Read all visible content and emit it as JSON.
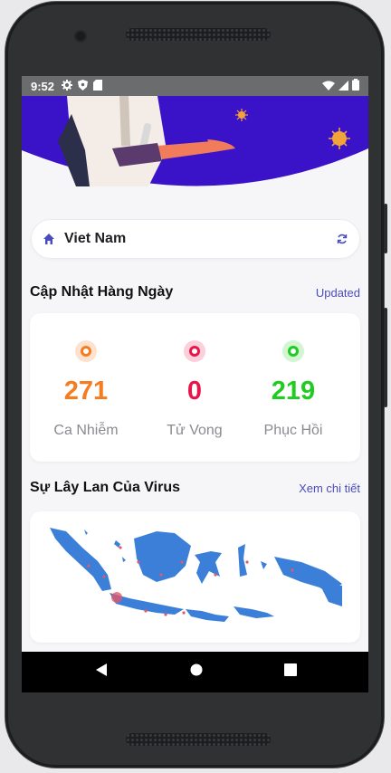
{
  "status_bar": {
    "time": "9:52"
  },
  "location": {
    "country": "Viet Nam"
  },
  "daily_update": {
    "title": "Cập Nhật Hàng Ngày",
    "link": "Updated",
    "stats": [
      {
        "value": "271",
        "label": "Ca Nhiễm",
        "color": "#f57c1f",
        "halo": "#fde3cf"
      },
      {
        "value": "0",
        "label": "Tử Vong",
        "color": "#e8154a",
        "halo": "#fbd0da"
      },
      {
        "value": "219",
        "label": "Phục Hồi",
        "color": "#1fcc1f",
        "halo": "#d2f5d2"
      }
    ]
  },
  "spread": {
    "title": "Sự Lây Lan Của Virus",
    "link": "Xem chi tiết"
  },
  "colors": {
    "hero": "#3a12c8",
    "map": "#3b7fd8",
    "accent": "#4b4dbd"
  }
}
